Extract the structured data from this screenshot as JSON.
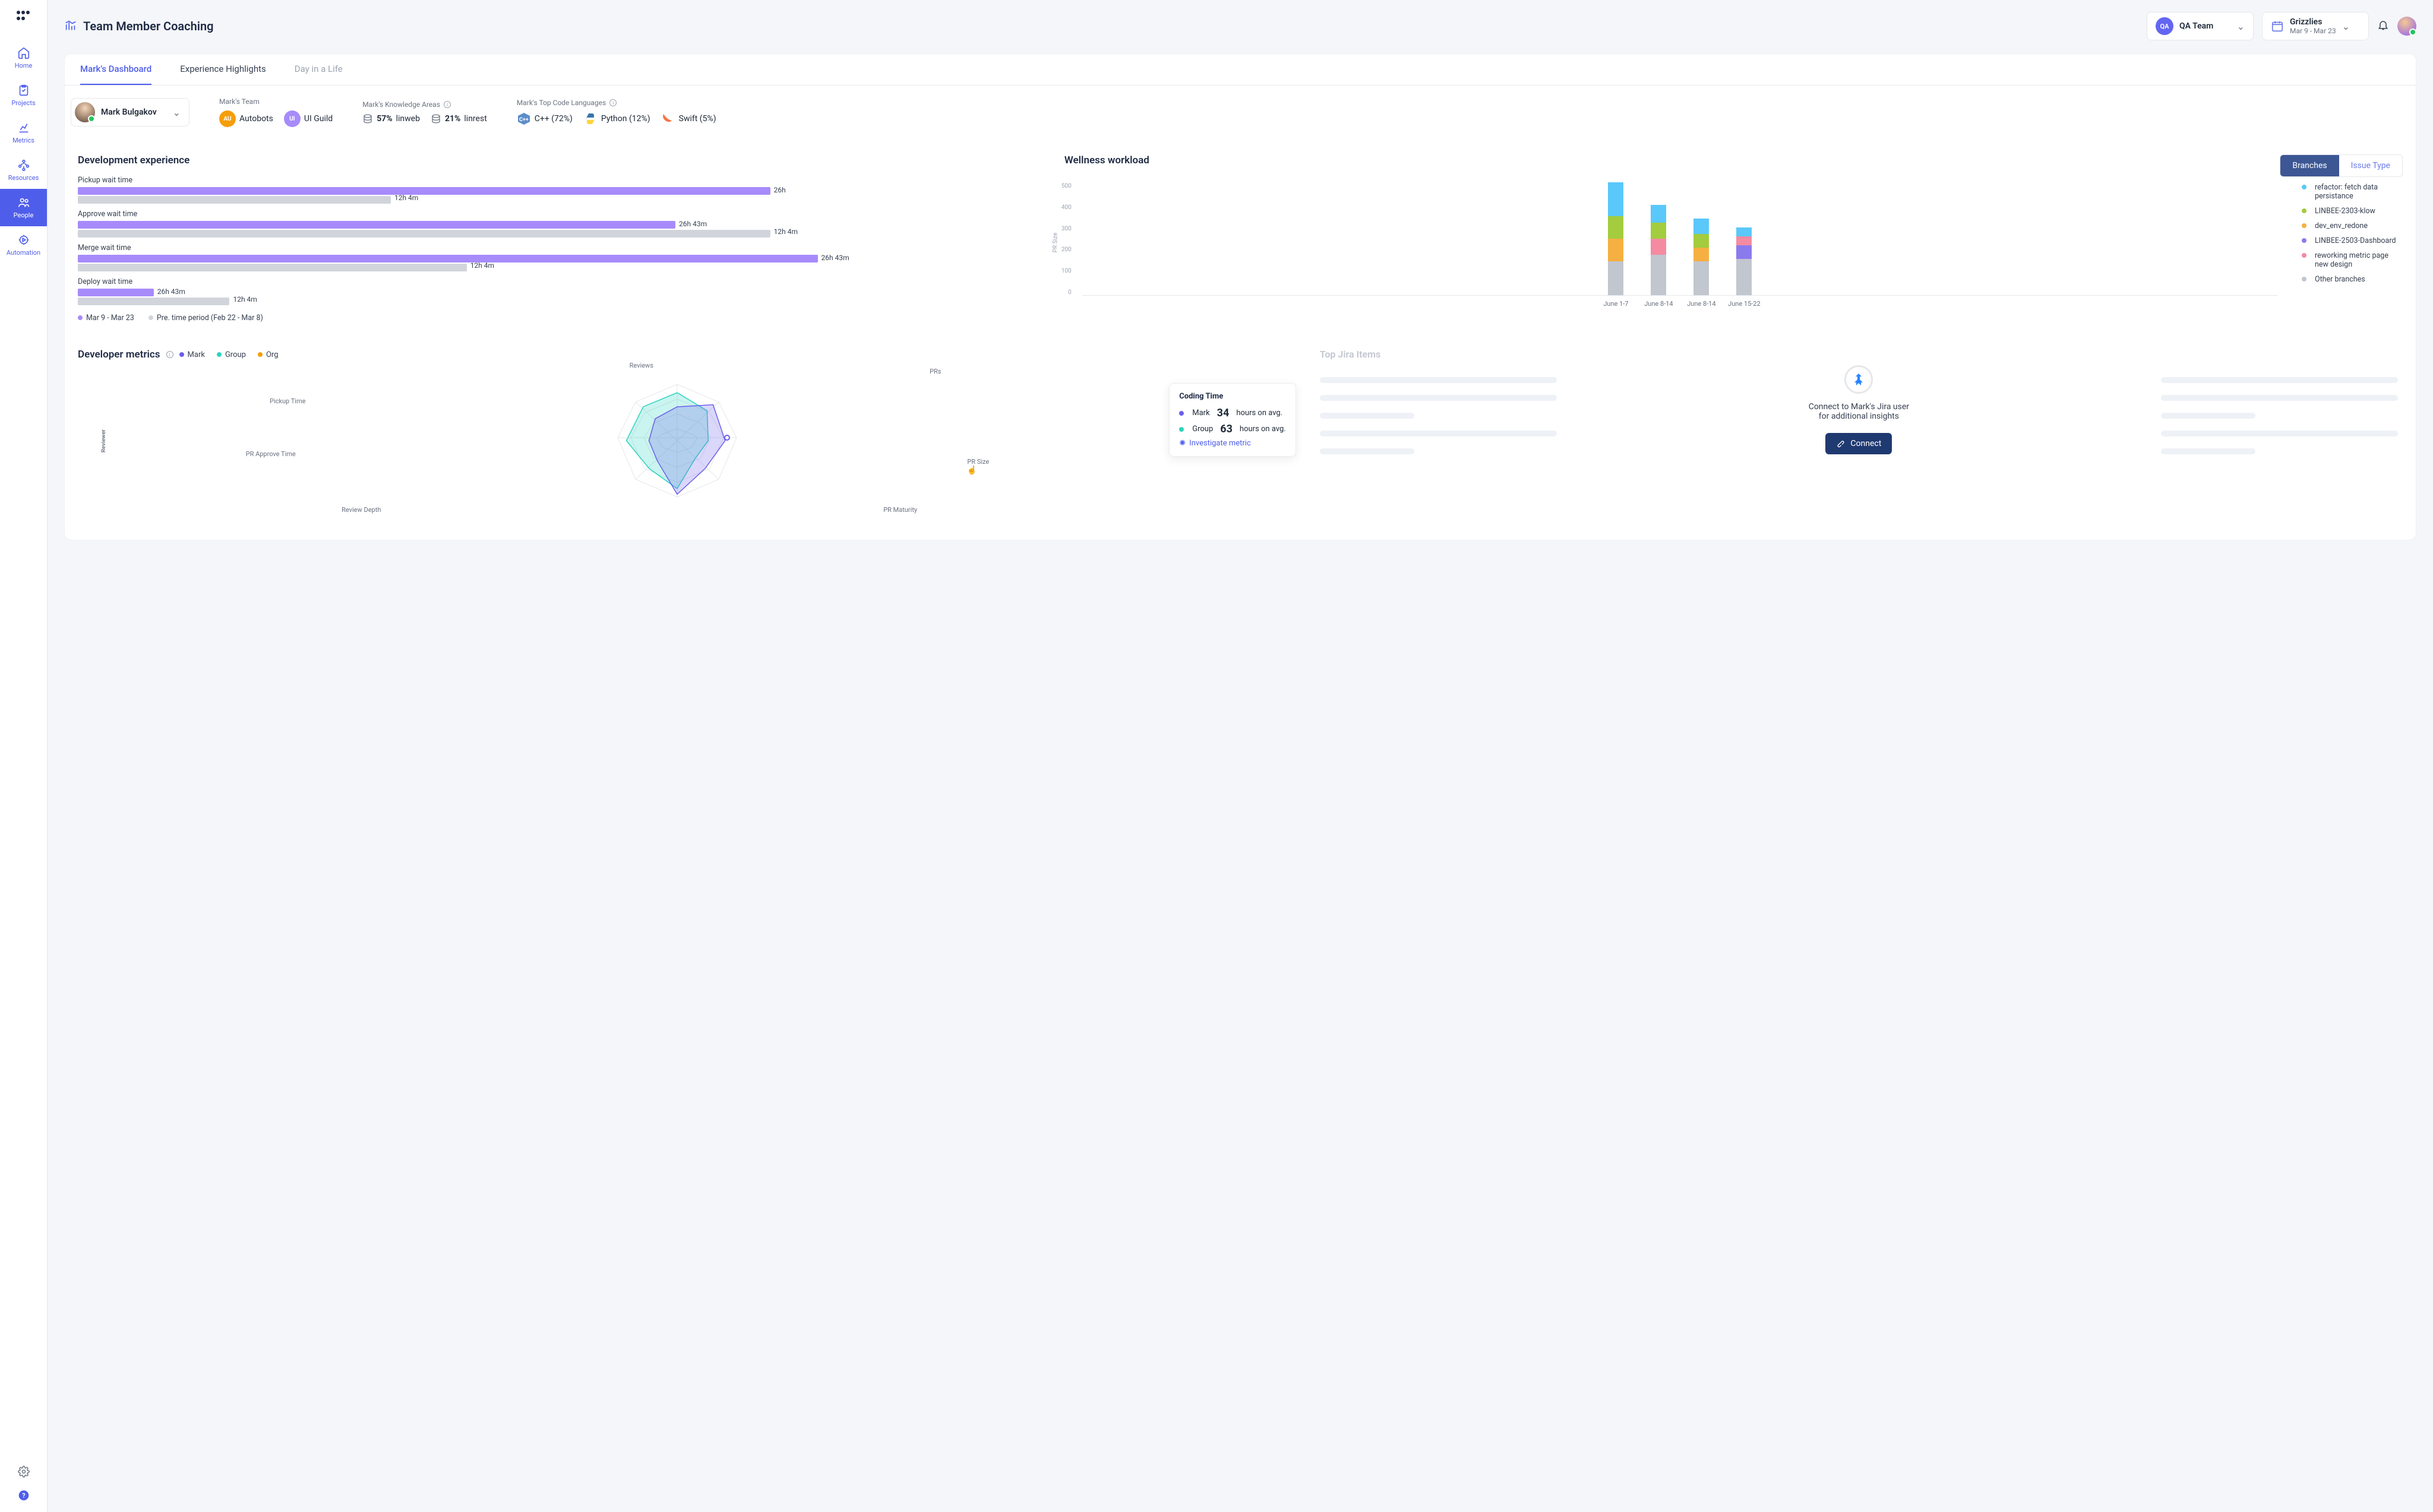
{
  "sidebar": {
    "items": [
      {
        "label": "Home",
        "icon": "home"
      },
      {
        "label": "Projects",
        "icon": "clipboard"
      },
      {
        "label": "Metrics",
        "icon": "chart"
      },
      {
        "label": "Resources",
        "icon": "resources"
      },
      {
        "label": "People",
        "icon": "people",
        "active": true
      },
      {
        "label": "Automation",
        "icon": "gear-play"
      }
    ]
  },
  "header": {
    "title": "Team Member Coaching",
    "team_selector": {
      "badge": "QA",
      "label": "QA Team"
    },
    "range_selector": {
      "title": "Grizzlies",
      "range": "Mar 9 - Mar 23"
    }
  },
  "tabs": [
    {
      "label": "Mark's Dashboard",
      "state": "active"
    },
    {
      "label": "Experience Highlights",
      "state": ""
    },
    {
      "label": "Day in a Life",
      "state": "disabled"
    }
  ],
  "member": {
    "name": "Mark Bulgakov",
    "team_label": "Mark's Team",
    "teams": [
      {
        "badge": "AU",
        "name": "Autobots",
        "color": "#f59e0b"
      },
      {
        "badge": "UI",
        "name": "UI Guild",
        "color": "#a78bfa"
      }
    ],
    "knowledge_label": "Mark's Knowledge Areas",
    "knowledge": [
      {
        "pct": "57%",
        "name": "linweb"
      },
      {
        "pct": "21%",
        "name": "linrest"
      }
    ],
    "lang_label": "Mark's Top Code Languages",
    "languages": [
      {
        "name": "C++ (72%)",
        "icon": "cpp"
      },
      {
        "name": "Python (12%)",
        "icon": "python"
      },
      {
        "name": "Swift (5%)",
        "icon": "swift"
      }
    ]
  },
  "dev_exp": {
    "title": "Development experience",
    "rows": [
      {
        "label": "Pickup wait time",
        "cur": 73,
        "cur_v": "26h",
        "prev": 33,
        "prev_v": "12h 4m"
      },
      {
        "label": "Approve wait time",
        "cur": 63,
        "cur_v": "26h 43m",
        "prev": 73,
        "prev_v": "12h 4m"
      },
      {
        "label": "Merge wait time",
        "cur": 78,
        "cur_v": "26h 43m",
        "prev": 41,
        "prev_v": "12h 4m"
      },
      {
        "label": "Deploy wait time",
        "cur": 8,
        "cur_v": "26h 43m",
        "prev": 16,
        "prev_v": "12h 4m"
      }
    ],
    "legend_cur": "Mar 9 - Mar 23",
    "legend_prev": "Pre. time period (Feb 22 - Mar 8)"
  },
  "wellness": {
    "title": "Wellness workload",
    "toggle": {
      "on": "Branches",
      "off": "Issue Type"
    },
    "y_label": "PR Size",
    "y_ticks": [
      "500",
      "400",
      "300",
      "200",
      "100",
      "0"
    ],
    "legend": [
      {
        "color": "#5ac8fa",
        "label": "refactor: fetch data persistance"
      },
      {
        "color": "#a3cc3e",
        "label": "LINBEE-2303-klow"
      },
      {
        "color": "#f6b042",
        "label": "dev_env_redone"
      },
      {
        "color": "#8b7aed",
        "label": "LINBEE-2503-Dashboard"
      },
      {
        "color": "#f48ba1",
        "label": "reworking metric page new design"
      },
      {
        "color": "#c2c6cf",
        "label": "Other branches"
      }
    ],
    "bars": [
      {
        "x": "June 1-7",
        "seg": [
          {
            "c": "#c2c6cf",
            "h": 150
          },
          {
            "c": "#f6b042",
            "h": 100
          },
          {
            "c": "#a3cc3e",
            "h": 100
          },
          {
            "c": "#5ac8fa",
            "h": 150
          }
        ]
      },
      {
        "x": "June 8-14",
        "seg": [
          {
            "c": "#c2c6cf",
            "h": 180
          },
          {
            "c": "#f48ba1",
            "h": 70
          },
          {
            "c": "#a3cc3e",
            "h": 70
          },
          {
            "c": "#5ac8fa",
            "h": 80
          }
        ]
      },
      {
        "x": "June 8-14",
        "seg": [
          {
            "c": "#c2c6cf",
            "h": 150
          },
          {
            "c": "#f6b042",
            "h": 60
          },
          {
            "c": "#a3cc3e",
            "h": 60
          },
          {
            "c": "#5ac8fa",
            "h": 70
          }
        ]
      },
      {
        "x": "June 15-22",
        "seg": [
          {
            "c": "#c2c6cf",
            "h": 160
          },
          {
            "c": "#8b7aed",
            "h": 60
          },
          {
            "c": "#f48ba1",
            "h": 40
          },
          {
            "c": "#5ac8fa",
            "h": 40
          }
        ]
      }
    ]
  },
  "dev_metrics": {
    "title": "Developer metrics",
    "legend": [
      {
        "color": "#6b5eea",
        "label": "Mark"
      },
      {
        "color": "#2dd4bf",
        "label": "Group"
      },
      {
        "color": "#f59e0b",
        "label": "Org"
      }
    ],
    "axes": [
      "Reviews",
      "PRs",
      "Coding Time",
      "PR Size",
      "PR Maturity",
      "Review Depth",
      "PR Approve Time",
      "Pickup Time"
    ],
    "side_labels": {
      "reviewer": "Reviewer"
    },
    "tooltip": {
      "title": "Coding Time",
      "rows": [
        {
          "who": "Mark",
          "color": "#6b5eea",
          "val": "34",
          "suffix": "hours on avg."
        },
        {
          "who": "Group",
          "color": "#2dd4bf",
          "val": "63",
          "suffix": "hours on avg."
        }
      ],
      "link_label": "Investigate metric"
    }
  },
  "jira": {
    "title": "Top Jira Items",
    "text_line1": "Connect to Mark's Jira user",
    "text_line2": "for additional insights",
    "button": "Connect"
  },
  "chart_data": [
    {
      "type": "bar",
      "title": "Development experience",
      "categories": [
        "Pickup wait time",
        "Approve wait time",
        "Merge wait time",
        "Deploy wait time"
      ],
      "series": [
        {
          "name": "Mar 9 - Mar 23",
          "display": [
            "26h",
            "26h 43m",
            "26h 43m",
            "26h 43m"
          ],
          "rel_width_pct": [
            73,
            63,
            78,
            8
          ]
        },
        {
          "name": "Pre. time period (Feb 22 - Mar 8)",
          "display": [
            "12h 4m",
            "12h 4m",
            "12h 4m",
            "12h 4m"
          ],
          "rel_width_pct": [
            33,
            73,
            41,
            16
          ]
        }
      ]
    },
    {
      "type": "stacked_bar",
      "title": "Wellness workload",
      "ylabel": "PR Size",
      "ylim": [
        0,
        500
      ],
      "categories": [
        "June 1-7",
        "June 8-14",
        "June 8-14",
        "June 15-22"
      ],
      "series": [
        {
          "name": "Other branches",
          "color": "#c2c6cf",
          "values": [
            150,
            180,
            150,
            160
          ]
        },
        {
          "name": "dev_env_redone",
          "color": "#f6b042",
          "values": [
            100,
            0,
            60,
            0
          ]
        },
        {
          "name": "reworking metric page new design",
          "color": "#f48ba1",
          "values": [
            0,
            70,
            0,
            40
          ]
        },
        {
          "name": "LINBEE-2503-Dashboard",
          "color": "#8b7aed",
          "values": [
            0,
            0,
            0,
            60
          ]
        },
        {
          "name": "LINBEE-2303-klow",
          "color": "#a3cc3e",
          "values": [
            100,
            70,
            60,
            0
          ]
        },
        {
          "name": "refactor: fetch data persistance",
          "color": "#5ac8fa",
          "values": [
            150,
            80,
            70,
            40
          ]
        }
      ]
    },
    {
      "type": "radar",
      "title": "Developer metrics",
      "axes": [
        "Reviews",
        "PRs",
        "Coding Time",
        "PR Size",
        "PR Maturity",
        "Review Depth",
        "PR Approve Time",
        "Pickup Time"
      ],
      "series": [
        {
          "name": "Mark",
          "color": "#6b5eea",
          "values": [
            0.6,
            0.9,
            0.85,
            0.7,
            0.95,
            0.5,
            0.5,
            0.55
          ]
        },
        {
          "name": "Group",
          "color": "#2dd4bf",
          "values": [
            0.85,
            0.75,
            0.55,
            0.45,
            0.85,
            0.7,
            0.9,
            0.85
          ]
        }
      ],
      "tooltip": {
        "axis": "Coding Time",
        "Mark": "34 hours on avg.",
        "Group": "63 hours on avg."
      }
    }
  ]
}
